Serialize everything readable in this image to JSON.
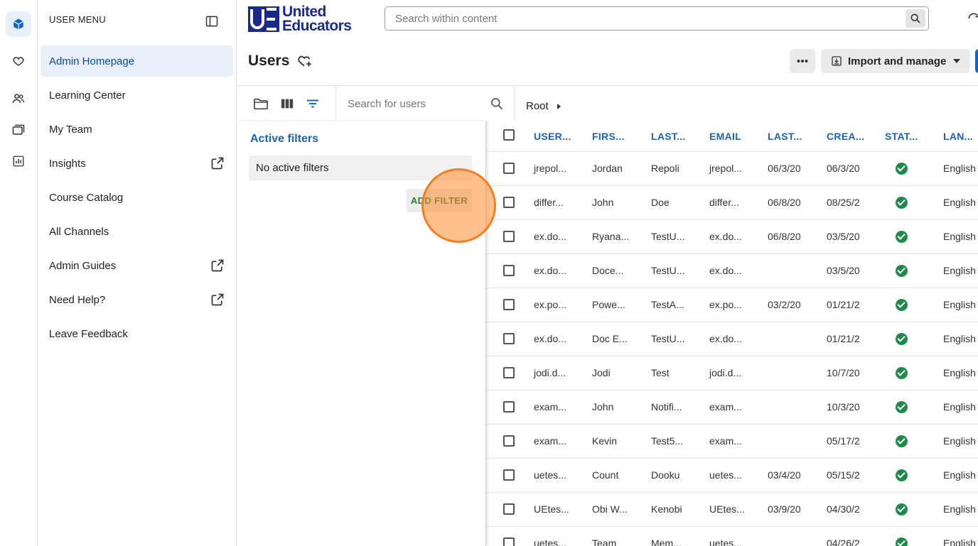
{
  "logo": {
    "line1": "United",
    "line2": "Educators",
    "mark": "UE"
  },
  "header": {
    "search_placeholder": "Search within content"
  },
  "menu": {
    "title": "USER MENU",
    "items": [
      {
        "label": "Admin Homepage",
        "external": false,
        "active": true
      },
      {
        "label": "Learning Center",
        "external": false
      },
      {
        "label": "My Team",
        "external": false
      },
      {
        "label": "Insights",
        "external": true
      },
      {
        "label": "Course Catalog",
        "external": false
      },
      {
        "label": "All Channels",
        "external": false
      },
      {
        "label": "Admin Guides",
        "external": true
      },
      {
        "label": "Need Help?",
        "external": true
      },
      {
        "label": "Leave Feedback",
        "external": false
      }
    ]
  },
  "rail": {
    "icons": [
      "cube-icon",
      "heart-icon",
      "people-icon",
      "folders-icon",
      "chart-icon"
    ]
  },
  "page": {
    "title": "Users",
    "import_label": "Import and manage"
  },
  "toolbar": {
    "user_search_placeholder": "Search for users",
    "breadcrumb_root": "Root"
  },
  "filters": {
    "title": "Active filters",
    "empty_text": "No active filters",
    "add_label": "ADD FILTER"
  },
  "table": {
    "columns": [
      "USER...",
      "FIRS...",
      "LAST...",
      "EMAIL",
      "LAST...",
      "CREA...",
      "STAT...",
      "LAN..."
    ],
    "rows": [
      [
        "jrepol...",
        "Jordan",
        "Repoli",
        "jrepol...",
        "06/3/20",
        "06/3/20",
        "active",
        "English"
      ],
      [
        "differ...",
        "John",
        "Doe",
        "differ...",
        "06/8/20",
        "08/25/2",
        "active",
        "English"
      ],
      [
        "ex.do...",
        "Ryana...",
        "TestU...",
        "ex.do...",
        "06/8/20",
        "03/5/20",
        "active",
        "English"
      ],
      [
        "ex.do...",
        "Doce...",
        "TestU...",
        "ex.do...",
        "",
        "03/5/20",
        "active",
        "English"
      ],
      [
        "ex.po...",
        "Powe...",
        "TestA...",
        "ex.po...",
        "03/2/20",
        "01/21/2",
        "active",
        "English"
      ],
      [
        "ex.do...",
        "Doc E...",
        "TestU...",
        "ex.do...",
        "",
        "01/21/2",
        "active",
        "English"
      ],
      [
        "jodi.d...",
        "Jodi",
        "Test",
        "jodi.d...",
        "",
        "10/7/20",
        "active",
        "English"
      ],
      [
        "exam...",
        "John",
        "Notifi...",
        "exam...",
        "",
        "10/3/20",
        "active",
        "English"
      ],
      [
        "exam...",
        "Kevin",
        "Test5...",
        "exam...",
        "",
        "05/17/2",
        "active",
        "English"
      ],
      [
        "uetes...",
        "Count",
        "Dooku",
        "uetes...",
        "03/4/20",
        "05/15/2",
        "active",
        "English"
      ],
      [
        "UEtes...",
        "Obi W...",
        "Kenobi",
        "UEtes...",
        "03/9/20",
        "04/30/2",
        "active",
        "English"
      ],
      [
        "uetes...",
        "Team",
        "Mem...",
        "uetes...",
        "",
        "04/26/2",
        "active",
        "English"
      ]
    ]
  },
  "colors": {
    "accent": "#1e63ad",
    "active_bg": "#e8f0fb",
    "status_green": "#1e8a4c",
    "add_filter_text": "#2e7d32",
    "logo_blue": "#1a2a8a"
  }
}
